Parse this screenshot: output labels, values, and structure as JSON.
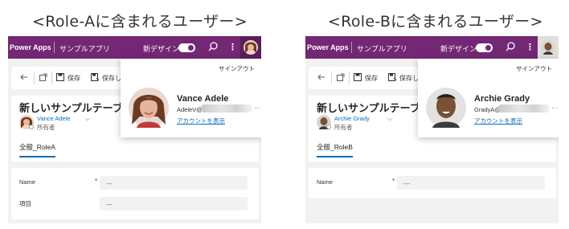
{
  "captions": {
    "role_a": "<Role-Aに含まれるユーザー>",
    "role_b": "<Role-Bに含まれるユーザー>"
  },
  "app": {
    "brand": "Power Apps",
    "app_name": "サンプルアプリ",
    "new_design_label": "新デザイン",
    "more_label": "⋮"
  },
  "command_bar": {
    "save": "保存",
    "save_and_close_a": "保存して",
    "save_and_close_b": "保存し"
  },
  "form": {
    "title": "新しいサンプルテーブル",
    "owner_role": "所有者",
    "field_required_marker": "*",
    "field_placeholder": "---"
  },
  "popup": {
    "sign_out": "サインアウト",
    "view_account": "アカウントを表示",
    "more": "···"
  },
  "panels": {
    "role_a": {
      "user_name": "Vance Adele",
      "user_email": "AdeleV@",
      "tab_label": "全般_RoleA",
      "fields": [
        {
          "label": "Name",
          "value": "---"
        },
        {
          "label": "項目",
          "value": "---"
        }
      ]
    },
    "role_b": {
      "user_name": "Archie Grady",
      "user_email": "GradyA@",
      "tab_label": "全般_RoleB",
      "fields": [
        {
          "label": "Name",
          "value": "---"
        }
      ]
    }
  },
  "colors": {
    "header": "#742774",
    "link": "#0f6cbd",
    "required": "#a4262c"
  }
}
